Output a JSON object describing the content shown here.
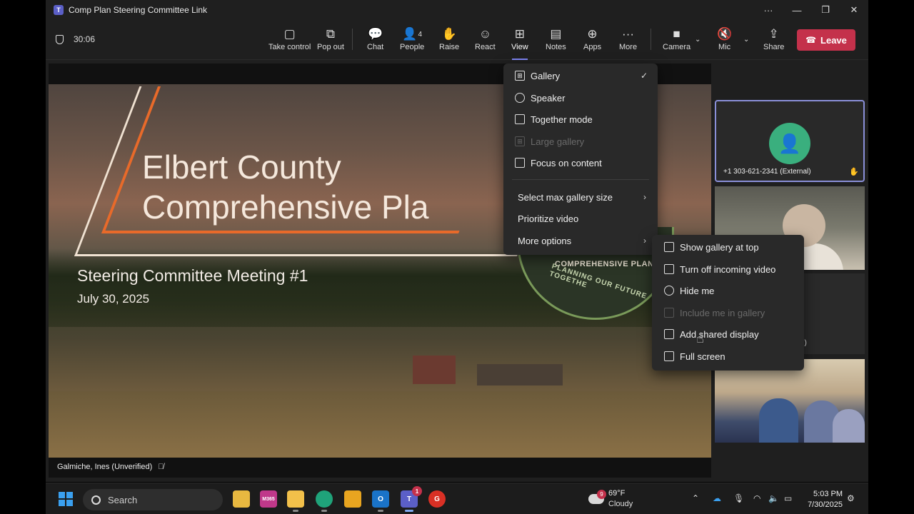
{
  "window": {
    "title": "Comp Plan Steering Committee Link",
    "controls": {
      "more": "···",
      "minimize": "—",
      "restore": "❐",
      "close": "✕"
    }
  },
  "toolbar": {
    "timer": "30:06",
    "buttons": [
      {
        "label": "Take control",
        "icon": "take-control-icon",
        "glyph": "▢"
      },
      {
        "label": "Pop out",
        "icon": "pop-out-icon",
        "glyph": "⧉"
      },
      {
        "label": "Chat",
        "icon": "chat-icon",
        "glyph": "💬"
      },
      {
        "label": "People",
        "icon": "people-icon",
        "glyph": "👤",
        "count": "4"
      },
      {
        "label": "Raise",
        "icon": "raise-hand-icon",
        "glyph": "✋"
      },
      {
        "label": "React",
        "icon": "react-icon",
        "glyph": "☺"
      },
      {
        "label": "View",
        "icon": "view-icon",
        "glyph": "⊞"
      },
      {
        "label": "Notes",
        "icon": "notes-icon",
        "glyph": "▤"
      },
      {
        "label": "Apps",
        "icon": "apps-icon",
        "glyph": "⊕"
      },
      {
        "label": "More",
        "icon": "more-icon",
        "glyph": "···"
      },
      {
        "label": "Camera",
        "icon": "camera-icon",
        "glyph": "■"
      },
      {
        "label": "Mic",
        "icon": "mic-muted-icon",
        "glyph": "🔇"
      },
      {
        "label": "Share",
        "icon": "share-icon",
        "glyph": "⇪"
      }
    ],
    "leave_label": "Leave",
    "accent": "#c4314b"
  },
  "slide": {
    "headline_line1": "Elbert County",
    "headline_line2": "Comprehensive Pla",
    "subtitle": "Steering Committee Meeting #1",
    "date": "July 30, 2025",
    "seal_text1": "COMPREHENSIVE PLAN",
    "seal_text2": "PLANNING OUR FUTURE TOGETHE",
    "presenter": "Galmiche, Ines (Unverified)"
  },
  "gallery": {
    "tile1_name": "+1 303-621-2341 (External)",
    "tile3_name": "d)"
  },
  "view_menu": {
    "items": [
      {
        "label": "Gallery",
        "checked": true
      },
      {
        "label": "Speaker"
      },
      {
        "label": "Together mode"
      },
      {
        "label": "Large gallery",
        "disabled": true
      },
      {
        "label": "Focus on content"
      },
      {
        "label": "Select max gallery size"
      },
      {
        "label": "Prioritize video"
      },
      {
        "label": "More options"
      }
    ]
  },
  "more_options_menu": {
    "items": [
      {
        "label": "Show gallery at top"
      },
      {
        "label": "Turn off incoming video"
      },
      {
        "label": "Hide me"
      },
      {
        "label": "Include me in gallery",
        "disabled": true
      },
      {
        "label": "Add shared display"
      },
      {
        "label": "Full screen"
      }
    ]
  },
  "taskbar": {
    "search_placeholder": "Search",
    "teams_badge": "1",
    "weather_badge": "9",
    "temperature": "69°F",
    "condition": "Cloudy",
    "time": "5:03 PM",
    "date": "7/30/2025",
    "apps": [
      {
        "icon": "file-explorer-icon",
        "label": "",
        "color": "#e8b840"
      },
      {
        "icon": "microsoft365-icon",
        "label": "M365",
        "color": "#c0388a"
      },
      {
        "icon": "folder-icon",
        "label": "",
        "color": "#f2c04a"
      },
      {
        "icon": "edge-icon",
        "label": "",
        "color": "#1fa37a"
      },
      {
        "icon": "store-icon",
        "label": "",
        "color": "#e8a520"
      },
      {
        "icon": "outlook-icon",
        "label": "O",
        "color": "#1a73c8"
      },
      {
        "icon": "teams-icon",
        "label": "T",
        "color": "#5b5fc7"
      },
      {
        "icon": "google-app-icon",
        "label": "G",
        "color": "#d93025"
      }
    ]
  }
}
